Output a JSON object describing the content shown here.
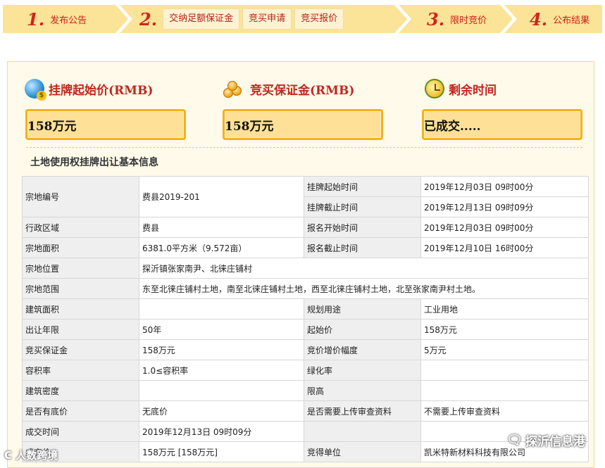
{
  "steps": [
    {
      "num": "1.",
      "label": "发布公告"
    },
    {
      "num": "2.",
      "subs": [
        "交纳足额保证金",
        "竞买申请",
        "竞买报价"
      ]
    },
    {
      "num": "3.",
      "label": "限时竞价"
    },
    {
      "num": "4.",
      "label": "公布结果"
    }
  ],
  "summary": {
    "start_price": {
      "label": "挂牌起始价(RMB)",
      "value": "158万元",
      "icon": "globe-money-icon"
    },
    "deposit": {
      "label": "竞买保证金(RMB)",
      "value": "158万元",
      "icon": "coins-icon"
    },
    "remaining": {
      "label": "剩余时间",
      "value": "已成交.....",
      "icon": "alarm-clock-icon"
    }
  },
  "section_title": "土地使用权挂牌出让基本信息",
  "table": {
    "parcel_no_label": "宗地编号",
    "parcel_no": "费县2019-201",
    "list_start_label": "挂牌起始时间",
    "list_start": "2019年12月03日 09时00分",
    "list_end_label": "挂牌截止时间",
    "list_end": "2019年12月13日 09时09分",
    "district_label": "行政区域",
    "district": "费县",
    "reg_start_label": "报名开始时间",
    "reg_start": "2019年12月03日 09时00分",
    "area_label": "宗地面积",
    "area": "6381.0平方米（9.572亩）",
    "reg_end_label": "报名截止时间",
    "reg_end": "2019年12月10日 16时00分",
    "location_label": "宗地位置",
    "location": "探沂镇张家南尹、北徕庄铺村",
    "scope_label": "宗地范围",
    "scope": "东至北徕庄铺村土地，南至北徕庄铺村土地，西至北徕庄铺村土地，北至张家南尹村土地。",
    "build_area_label": "建筑面积",
    "build_area": "",
    "usage_label": "规划用途",
    "usage": "工业用地",
    "years_label": "出让年限",
    "years": "50年",
    "start_price_label": "起始价",
    "start_price": "158万元",
    "deposit_label": "竞买保证金",
    "deposit": "158万元",
    "increment_label": "竞价增价幅度",
    "increment": "5万元",
    "far_label": "容积率",
    "far": "1.0≤容积率",
    "green_label": "绿化率",
    "green": "",
    "density_label": "建筑密度",
    "density": "",
    "height_label": "限高",
    "height": "",
    "reserve_label": "是否有底价",
    "reserve": "无底价",
    "review_label": "是否需要上传审查资料",
    "review": "不需要上传审查资料",
    "deal_time_label": "成交时间",
    "deal_time": "2019年12月13日 09时09分",
    "deal_price_label": "成交价",
    "deal_price": "158万元 [158万元]",
    "winner_label": "竞得单位",
    "winner": "凯米特新材料科技有限公司"
  },
  "watermark_right": "探沂信息港",
  "watermark_left": "C 人数跨境"
}
